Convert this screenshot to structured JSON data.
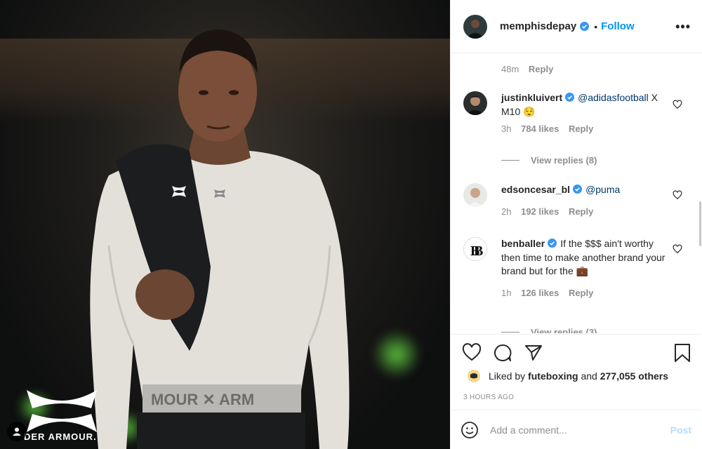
{
  "photo": {
    "brand_text": "DER ARMOUR.",
    "waistband_text": "MOUR ✕ ARM",
    "icon": "user-tag-icon"
  },
  "header": {
    "username": "memphisdepay",
    "verified": true,
    "dot": "•",
    "follow_label": "Follow",
    "more_label": "•••"
  },
  "comments": [
    {
      "meta_time": "48m",
      "reply": "Reply"
    },
    {
      "user": "justinkluivert",
      "verified": true,
      "mention": "@adidasfootball",
      "text": "X M10",
      "emoji": "😌",
      "time": "3h",
      "likes": "784 likes",
      "reply": "Reply",
      "view_replies": "View replies (8)"
    },
    {
      "user": "edsoncesar_bl",
      "verified": true,
      "mention": "@puma",
      "text": "",
      "time": "2h",
      "likes": "192 likes",
      "reply": "Reply"
    },
    {
      "user": "benballer",
      "verified": true,
      "text": "If the $$$ ain't worthy then time to make another brand your brand but for the",
      "emoji": "💼",
      "time": "1h",
      "likes": "126 likes",
      "reply": "Reply",
      "view_replies": "View replies (3)"
    }
  ],
  "actions": {
    "liked_by_prefix": "Liked by",
    "liked_by_user": "futeboxing",
    "liked_by_and": "and",
    "liked_by_others": "277,055 others",
    "time_ago": "3 HOURS AGO"
  },
  "composer": {
    "placeholder": "Add a comment...",
    "post_label": "Post"
  },
  "colors": {
    "accent": "#0095f6",
    "verified": "#3897f0",
    "post_disabled": "#b2dffc",
    "secondary_text": "#8e8e8e"
  }
}
